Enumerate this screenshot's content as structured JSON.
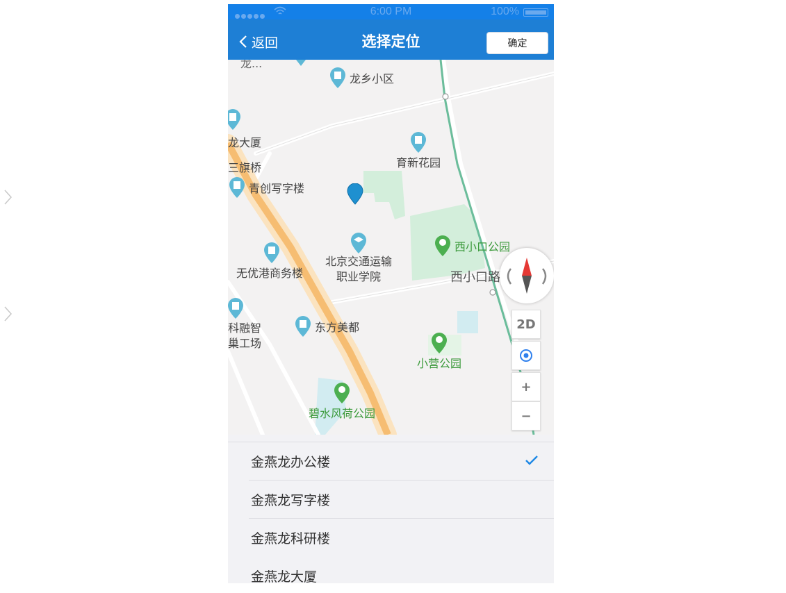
{
  "status_bar": {
    "time": "6:00 PM",
    "battery": "100%"
  },
  "nav": {
    "back_label": "返回",
    "title": "选择定位",
    "confirm_label": "确定"
  },
  "map": {
    "labels": {
      "top_partial": "龙...",
      "longxiang": "龙乡小区",
      "dasha": "龙大厦",
      "sanqiqiao": "三旗桥",
      "yuxin": "育新花园",
      "qingchuang": "青创写字楼",
      "xixiaokou_park": "西小口公园",
      "wuyougang": "无优港商务楼",
      "beijing_jiaotong_1": "北京交通运输",
      "beijing_jiaotong_2": "职业学院",
      "xixiaokou_road": "西小口路",
      "kerong_1": "科融智",
      "kerong_2": "巢工场",
      "dongfang": "东方美都",
      "xiaoying_park": "小营公园",
      "bishui_park": "碧水风荷公园"
    },
    "controls": {
      "mode_2d": "2D",
      "zoom_in": "+",
      "zoom_out": "−"
    }
  },
  "locations": [
    {
      "name": "金燕龙办公楼",
      "selected": true
    },
    {
      "name": "金燕龙写字楼",
      "selected": false
    },
    {
      "name": "金燕龙科研楼",
      "selected": false
    },
    {
      "name": "金燕龙大厦",
      "selected": false
    }
  ],
  "colors": {
    "accent": "#1e7fd5",
    "check": "#1e88e5",
    "park": "#d3eedb",
    "road_main": "#f6c380"
  }
}
